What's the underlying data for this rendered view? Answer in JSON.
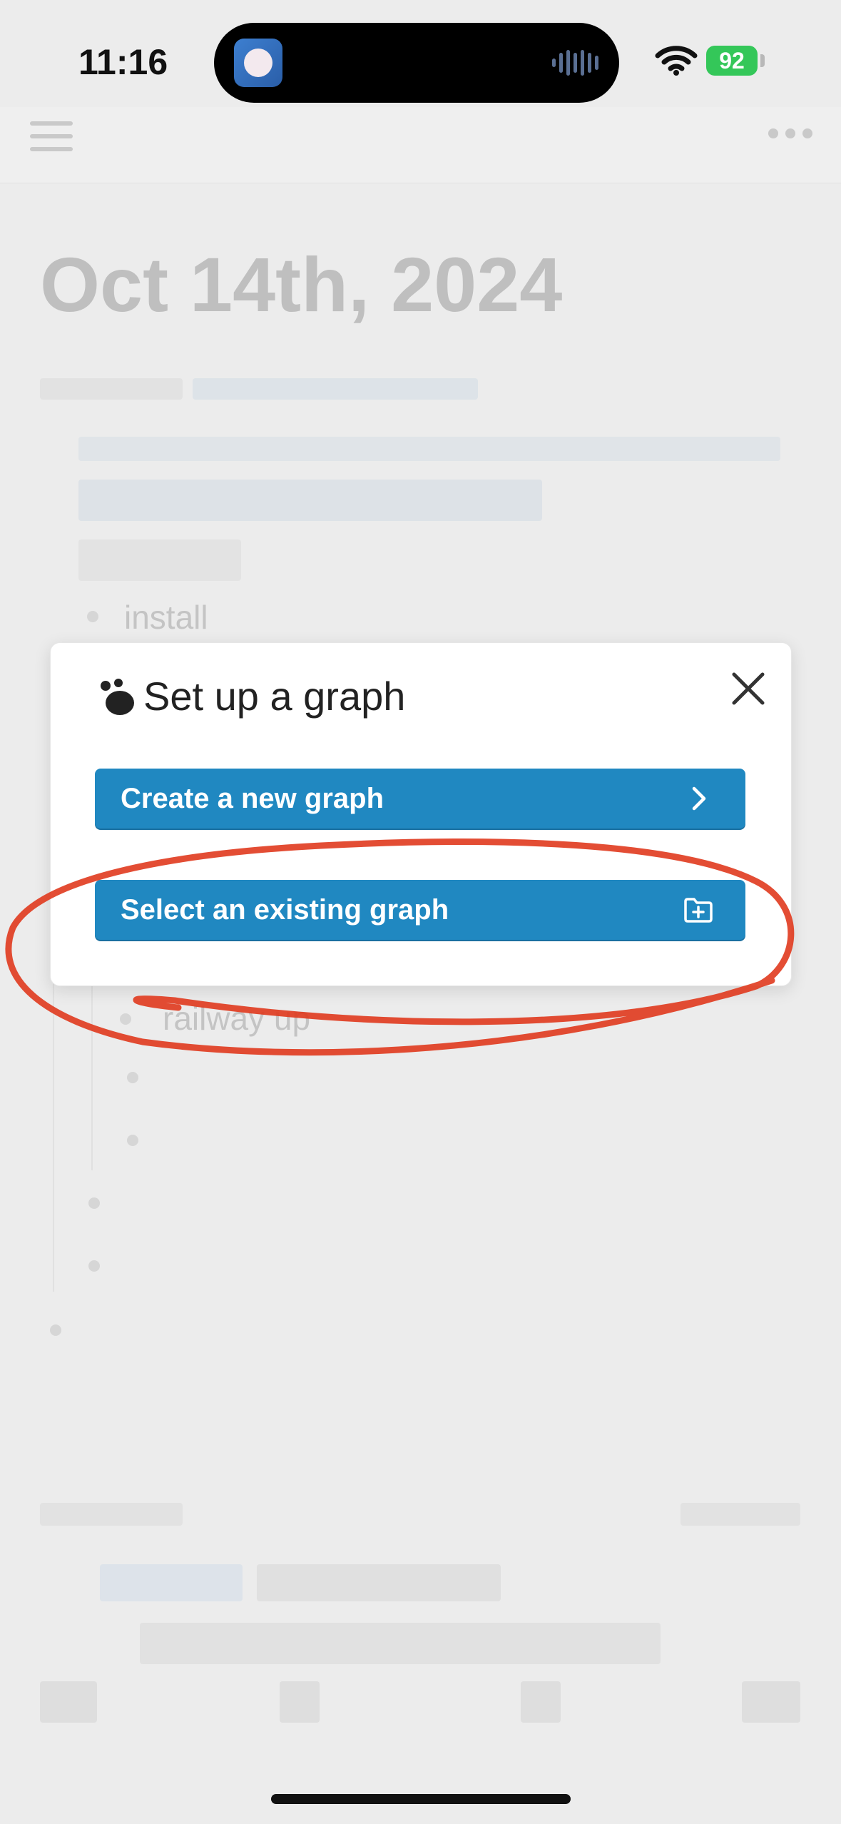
{
  "status_bar": {
    "time": "11:16",
    "battery": "92",
    "icons": [
      "app-icon",
      "audio-wave-icon",
      "wifi-icon",
      "battery-charging-icon"
    ]
  },
  "header": {
    "icons": [
      "menu-icon",
      "more-options-icon"
    ]
  },
  "page": {
    "title": "Oct 14th, 2024",
    "visible_items": [
      "install",
      "railway up"
    ]
  },
  "dialog": {
    "title": "Set up a graph",
    "create_button_label": "Create a new graph",
    "select_button_label": "Select an existing graph",
    "icons": [
      "graph-icon",
      "close-icon",
      "chevron-right-icon",
      "folder-plus-icon"
    ]
  },
  "colors": {
    "button_blue": "#2088c1",
    "annotation_red": "#e03a1e",
    "battery_green": "#34c759",
    "title_gray": "#bfbfbf"
  }
}
